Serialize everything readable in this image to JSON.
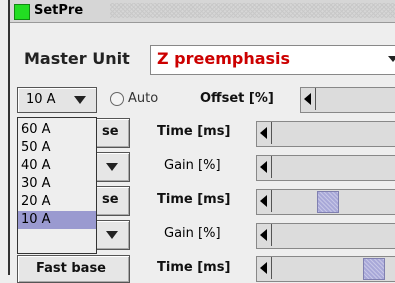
{
  "window": {
    "title": "SetPre"
  },
  "master": {
    "label": "Master Unit",
    "value": "Z preemphasis"
  },
  "range": {
    "selected": "10 A",
    "options": [
      "60 A",
      "50 A",
      "40 A",
      "30 A",
      "20 A",
      "10 A"
    ]
  },
  "auto": {
    "label": "Auto",
    "checked": false
  },
  "offset": {
    "label": "Offset [%]"
  },
  "rows": [
    {
      "button": "se",
      "param": "Time [ms]"
    },
    {
      "param": "Gain [%]"
    },
    {
      "button": "se",
      "param": "Time [ms]",
      "slider_position": 0.33
    },
    {
      "param": "Gain [%]"
    },
    {
      "button": "Fast base",
      "param": "Time [ms]",
      "slider_position": 0.83
    }
  ],
  "colors": {
    "accent": "#cc0000",
    "thumb": "#a8a8d8",
    "selected_item": "#9a9ad0"
  }
}
